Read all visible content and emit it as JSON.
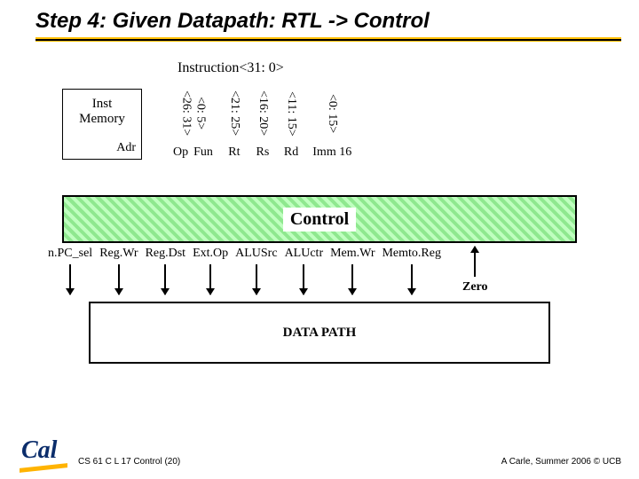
{
  "title": "Step 4: Given Datapath: RTL -> Control",
  "instruction_label": "Instruction<31: 0>",
  "inst_memory": {
    "title1": "Inst",
    "title2": "Memory",
    "adr": "Adr"
  },
  "bitfields": [
    {
      "range": "<26: 31>",
      "sublabel": "Op"
    },
    {
      "range": "<0: 5>",
      "sublabel": "Fun"
    },
    {
      "range": "<21: 25>",
      "sublabel": "Rt"
    },
    {
      "range": "<16: 20>",
      "sublabel": "Rs"
    },
    {
      "range": "<11: 15>",
      "sublabel": "Rd"
    },
    {
      "range": "<0: 15>",
      "sublabel": "Imm 16"
    }
  ],
  "control_label": "Control",
  "signals": {
    "list": [
      "n.PC_sel",
      "Reg.Wr",
      "Reg.Dst",
      "Ext.Op",
      "ALUSrc",
      "ALUctr",
      "Mem.Wr",
      "Memto.Reg"
    ],
    "up": "Zero"
  },
  "datapath_label": "DATA PATH",
  "footer_left": "CS 61 C L 17 Control (20)",
  "footer_right": "A Carle, Summer 2006 © UCB",
  "logo_text": "Cal"
}
